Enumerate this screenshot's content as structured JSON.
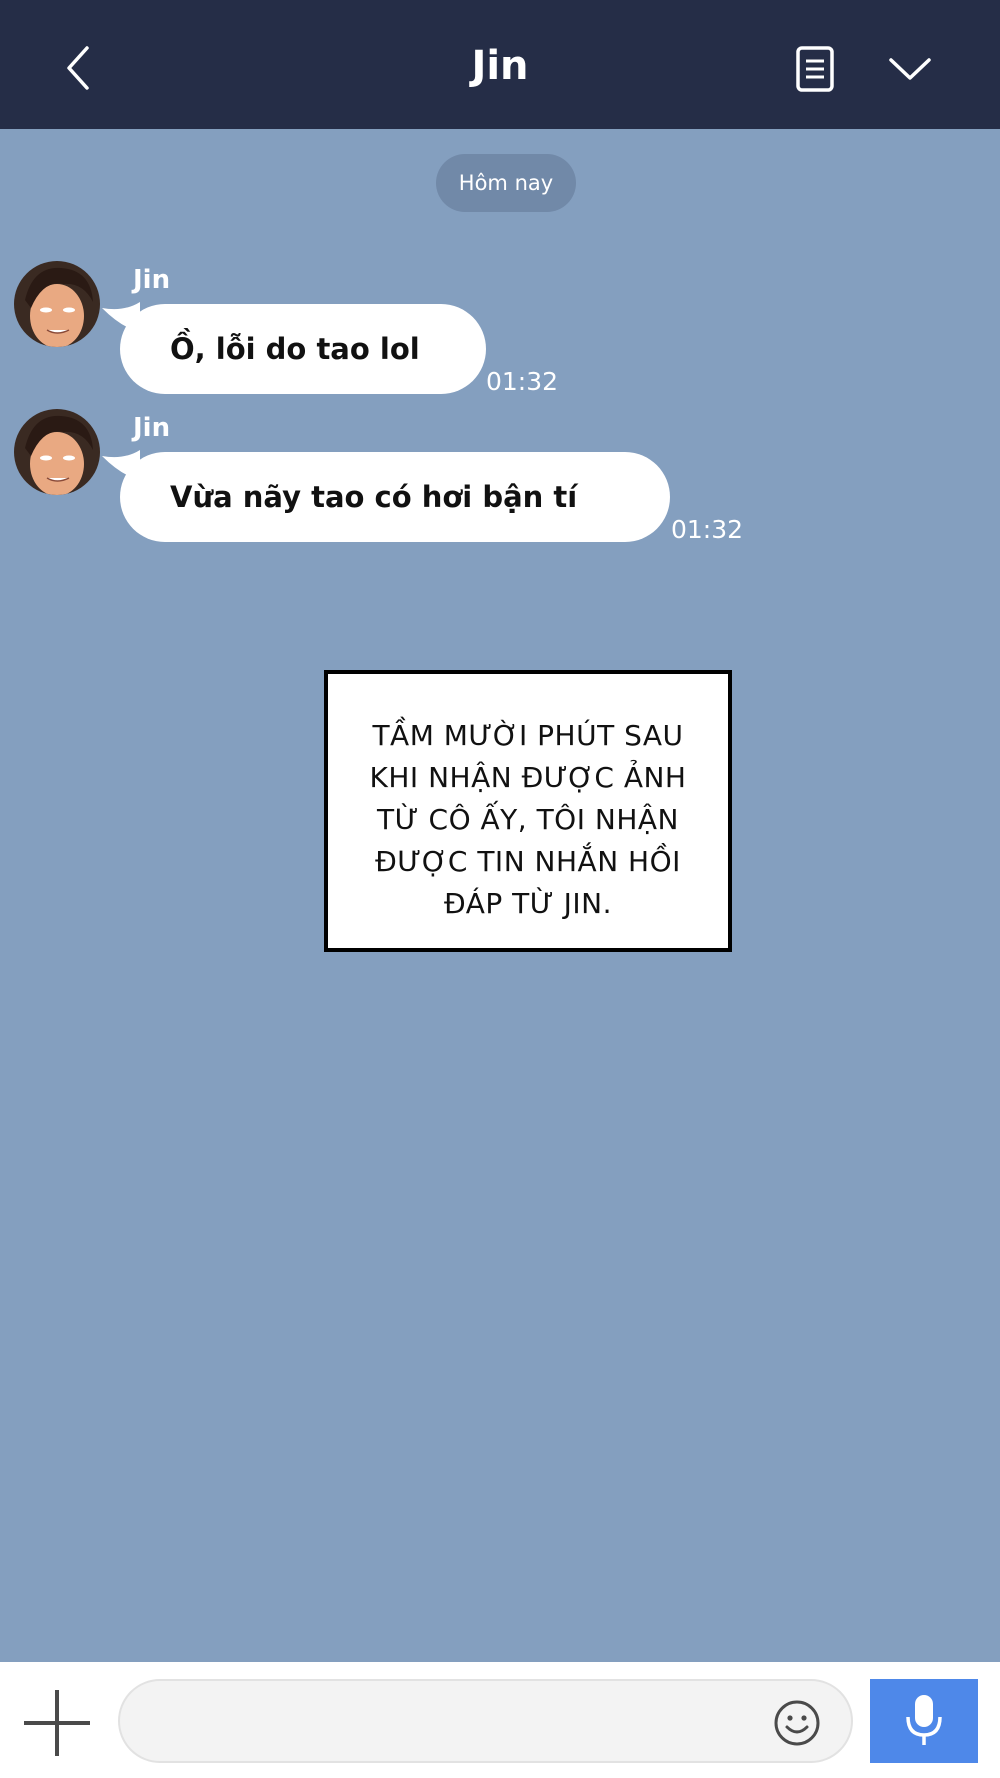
{
  "header": {
    "title": "Jin",
    "back_icon": "chevron-left-icon",
    "notes_icon": "notes-icon",
    "more_icon": "chevron-down-icon"
  },
  "date_separator": "Hôm nay",
  "messages": [
    {
      "sender": "Jin",
      "text": "Ồ, lỗi do tao lol",
      "time": "01:32"
    },
    {
      "sender": "Jin",
      "text": "Vừa nãy tao có hơi bận tí",
      "time": "01:32"
    }
  ],
  "narration": {
    "lines": [
      "TẦM MƯỜI PHÚT SAU",
      "KHI NHẬN ĐƯỢC ẢNH",
      "TỪ CÔ ẤY, TÔI NHẬN",
      "ĐƯỢC TIN NHẮN HỒI",
      "ĐÁP TỪ JIN."
    ]
  },
  "composer": {
    "input_value": "",
    "input_placeholder": "",
    "plus_icon": "plus-icon",
    "emoji_icon": "smiley-icon",
    "mic_icon": "microphone-icon"
  },
  "colors": {
    "header_bg": "#252d47",
    "chat_bg": "#849fbf",
    "date_pill_bg": "#7189a8",
    "bubble_bg": "#ffffff",
    "mic_button_bg": "#4e88e9"
  }
}
